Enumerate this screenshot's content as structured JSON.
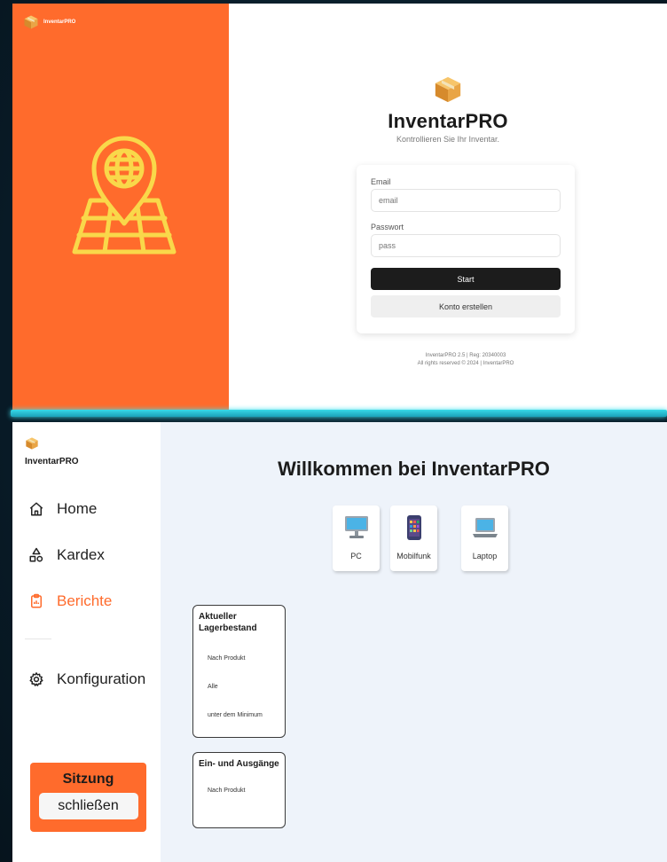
{
  "login": {
    "mini_brand": "InventarPRO",
    "title": "InventarPRO",
    "subtitle": "Kontrollieren Sie Ihr Inventar.",
    "email_label": "Email",
    "email_placeholder": "email",
    "password_label": "Passwort",
    "password_placeholder": "pass",
    "start_label": "Start",
    "create_label": "Konto erstellen",
    "footer_line1": "InventarPRO 2.5 | Reg: 20340003",
    "footer_line2": "All rights reserved © 2024 | InventarPRO"
  },
  "sidebar": {
    "brand": "InventarPRO",
    "items": [
      {
        "label": "Home",
        "icon": "home-icon"
      },
      {
        "label": "Kardex",
        "icon": "shapes-icon"
      },
      {
        "label": "Berichte",
        "icon": "clipboard-icon",
        "active": true
      },
      {
        "label": "Konfiguration",
        "icon": "gear-icon"
      }
    ],
    "logout_title": "Sitzung",
    "logout_button": "schließen"
  },
  "main": {
    "welcome": "Willkommen bei InventarPRO",
    "categories": [
      {
        "label": "PC",
        "icon": "desktop-icon"
      },
      {
        "label": "Mobilfunk",
        "icon": "phone-icon"
      },
      {
        "label": "Laptop",
        "icon": "laptop-icon"
      }
    ],
    "reports": [
      {
        "title": "Aktueller Lagerbestand",
        "items": [
          "Nach Produkt",
          "Alle",
          "unter dem Minimum"
        ]
      },
      {
        "title": "Ein- und Ausgänge",
        "items": [
          "Nach Produkt"
        ]
      }
    ]
  },
  "colors": {
    "accent": "#ff6b2c",
    "dark_button": "#1c1c1c",
    "main_bg": "#eef3fa",
    "map_yellow": "#f9d84a"
  }
}
